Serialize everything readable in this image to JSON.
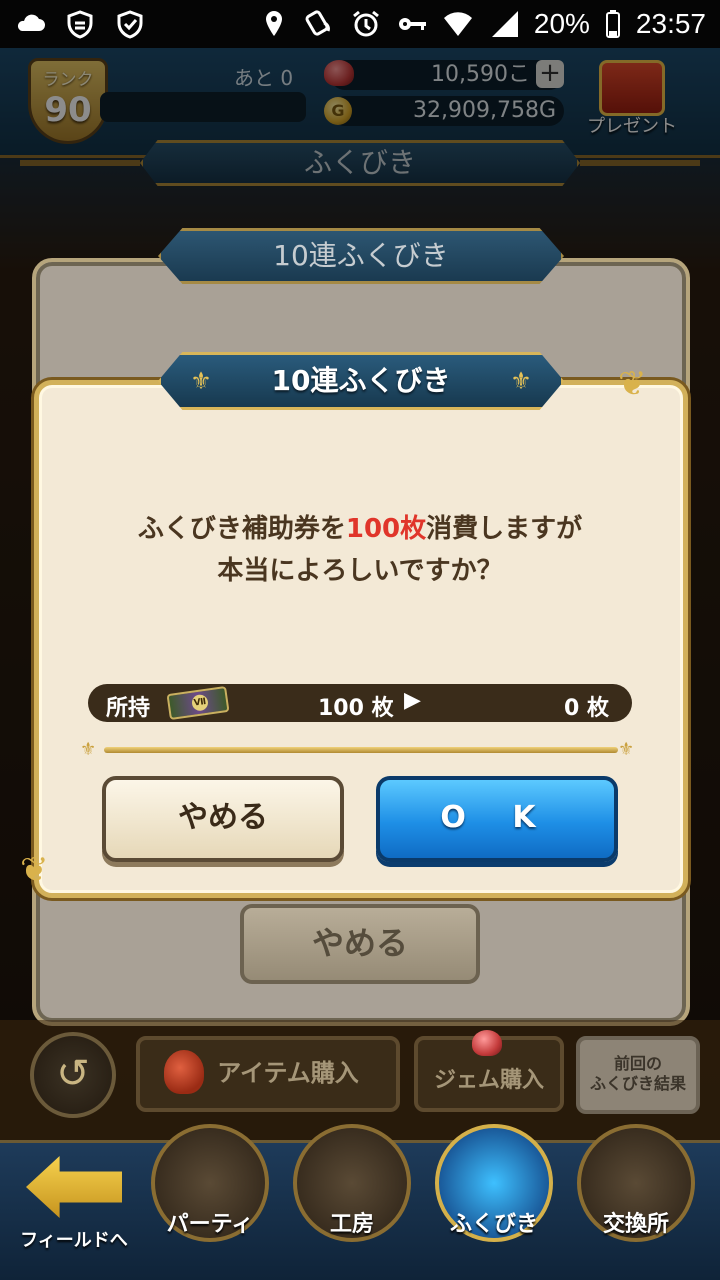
{
  "status_bar": {
    "battery": "20%",
    "time": "23:57",
    "icons": [
      "cloud-icon",
      "shield-check-icon",
      "shield-icon",
      "location-icon",
      "nfc-icon",
      "alarm-icon",
      "key-icon",
      "wifi-icon",
      "signal-icon",
      "battery-icon"
    ]
  },
  "header": {
    "rank_label": "ランク",
    "rank_value": "90",
    "remaining": "あと 0",
    "gems": "10,590こ",
    "gold": "32,909,758G",
    "gold_icon_letter": "G",
    "plus_label": "+",
    "present_label": "プレゼント"
  },
  "page_title": "ふくびき",
  "back_dialog": {
    "title": "10連ふくびき",
    "cancel_label": "やめる"
  },
  "dialog": {
    "title": "10連ふくびき",
    "message_prefix": "ふくびき補助券を",
    "message_highlight": "100枚",
    "message_suffix": "消費しますが",
    "message_line2": "本当によろしいですか？",
    "holdings_label": "所持",
    "ticket_badge": "Ⅶ",
    "holdings_from": "100 枚",
    "holdings_arrow": "▶",
    "holdings_to": "0 枚",
    "cancel_label": "やめる",
    "ok_label": "O K"
  },
  "actions": {
    "back_icon": "↺",
    "item_purchase": "アイテム購入",
    "gem_purchase": "ジェム購入",
    "prev_result_line1": "前回の",
    "prev_result_line2": "ふくびき結果"
  },
  "nav": {
    "field": "フィールドへ",
    "party": "パーティ",
    "workshop": "工房",
    "fukubiki": "ふくびき",
    "exchange": "交換所"
  },
  "colors": {
    "highlight_red": "#e0352a",
    "ok_blue": "#1e8fe6",
    "dialog_bg": "#f3e9d6",
    "gold_border": "#d2b15a"
  }
}
